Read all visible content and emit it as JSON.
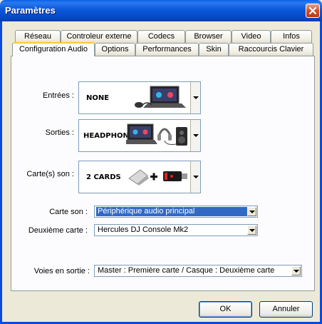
{
  "window": {
    "title": "Paramètres"
  },
  "tabs_row1": [
    "Réseau",
    "Controleur externe",
    "Codecs",
    "Browser",
    "Video",
    "Infos"
  ],
  "tabs_row2": [
    "Configuration Audio",
    "Options",
    "Performances",
    "Skin",
    "Raccourcis Clavier"
  ],
  "active_tab": "Configuration Audio",
  "audio": {
    "inputs": {
      "label": "Entrées :",
      "value": "NONE"
    },
    "outputs": {
      "label": "Sorties :",
      "value": "HEADPHONES"
    },
    "soundcards": {
      "label": "Carte(s) son :",
      "value": "2 CARDS"
    },
    "sound_card": {
      "label": "Carte son :",
      "value": "Périphérique audio principal"
    },
    "second_card": {
      "label": "Deuxième carte :",
      "value": "Hercules DJ Console Mk2"
    },
    "output_channels": {
      "label": "Voies en sortie :",
      "value": "Master : Première carte / Casque : Deuxième carte"
    }
  },
  "buttons": {
    "ok": "OK",
    "cancel": "Annuler"
  },
  "colors": {
    "titlebar": "#0A58D8",
    "window_bg": "#ECE9D8",
    "selection": "#316AC5",
    "active_tab_accent": "#FFC83C"
  }
}
